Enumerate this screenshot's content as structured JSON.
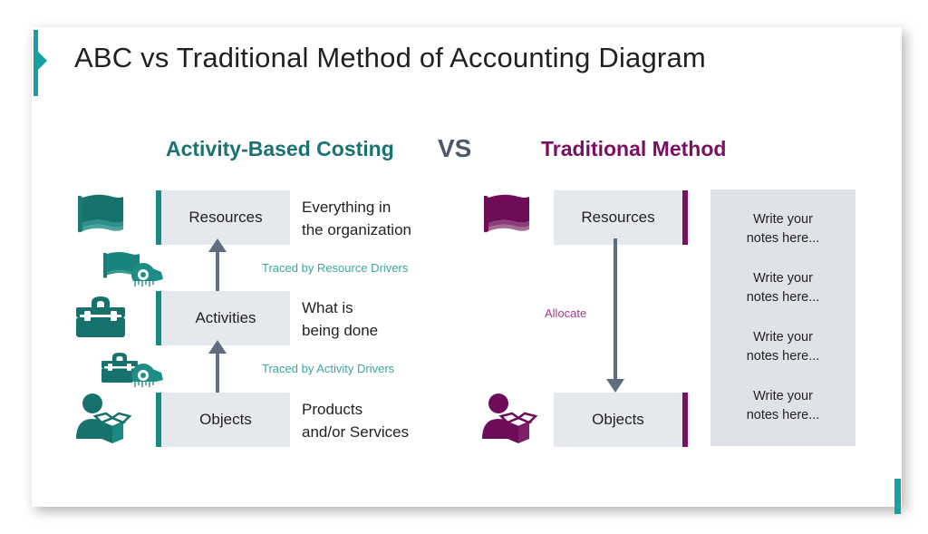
{
  "slide": {
    "title": "ABC vs Traditional Method of Accounting Diagram",
    "accent_teal": "#16a0a3",
    "accent_purple": "#7b0f63"
  },
  "headings": {
    "left": "Activity-Based Costing",
    "middle": "VS",
    "right": "Traditional Method"
  },
  "abc_column": {
    "boxes": [
      {
        "label": "Resources",
        "icon": "flag-icon",
        "description": "Everything in\nthe organization"
      },
      {
        "label": "Activities",
        "icon": "toolbox-icon",
        "description": "What is\nbeing done"
      },
      {
        "label": "Objects",
        "icon": "person-box-icon",
        "description": "Products\nand/or Services"
      }
    ],
    "connectors": [
      {
        "label": "Traced by Resource Drivers",
        "icon": "flag-measuring-tape-icon",
        "direction": "up"
      },
      {
        "label": "Traced by Activity Drivers",
        "icon": "toolbox-measuring-tape-icon",
        "direction": "up"
      }
    ]
  },
  "traditional_column": {
    "boxes": [
      {
        "label": "Resources",
        "icon": "flag-icon"
      },
      {
        "label": "Objects",
        "icon": "person-box-icon"
      }
    ],
    "connector": {
      "label": "Allocate",
      "direction": "down"
    }
  },
  "notes_panel": {
    "items": [
      "Write your\nnotes here...",
      "Write your\nnotes here...",
      "Write your\nnotes here...",
      "Write your\nnotes here..."
    ]
  }
}
